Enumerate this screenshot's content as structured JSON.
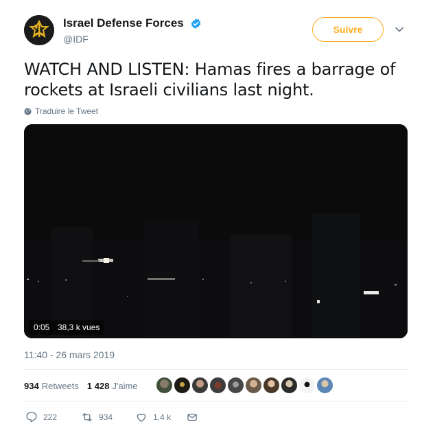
{
  "author": {
    "name": "Israel Defense Forces",
    "handle": "@IDF",
    "verified": true
  },
  "follow_button": {
    "label": "Suivre",
    "color": "#ffad1f"
  },
  "tweet": {
    "text": "WATCH AND LISTEN: Hamas fires a barrage of rockets at Israeli civilians last night.",
    "translate_label": "Traduire le Tweet"
  },
  "video": {
    "duration": "0:05",
    "views": "38,3 k vues"
  },
  "timestamp": "11:40 - 26 mars 2019",
  "stats": {
    "retweets_count": "934",
    "retweets_label": "Retweets",
    "likes_count": "1 428",
    "likes_label": "J'aime",
    "liker_avatars": 10
  },
  "actions": {
    "reply_count": "222",
    "retweet_count": "934",
    "like_count": "1,4 k"
  },
  "icons": {
    "verified": "verified-badge-icon",
    "caret": "chevron-down-icon",
    "globe": "globe-icon",
    "reply": "reply-icon",
    "retweet": "retweet-icon",
    "like": "heart-icon",
    "dm": "envelope-icon"
  },
  "colors": {
    "accent": "#ffad1f",
    "verified_blue": "#1da1f2",
    "muted": "#657786",
    "text": "#14171a"
  }
}
